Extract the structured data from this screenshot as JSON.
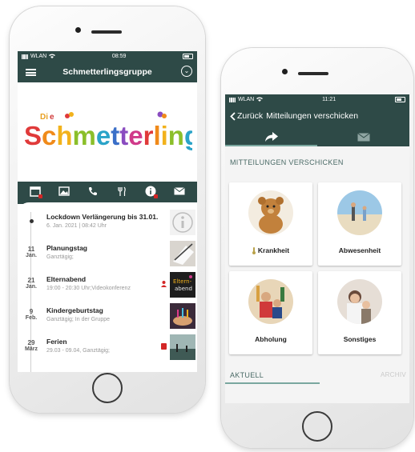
{
  "phone1": {
    "status": {
      "carrier": "WLAN",
      "time": "08:59"
    },
    "header": {
      "title": "Schmetterlingsgruppe",
      "menu_icon": "hamburger-icon",
      "toggle_icon": "chevron-down-icon"
    },
    "logo": {
      "prefix": "Die",
      "text": "Schmetterlinge"
    },
    "toolbar_icons": [
      "calendar-icon",
      "image-icon",
      "phone-icon",
      "cutlery-icon",
      "info-icon",
      "mail-icon"
    ],
    "feed": [
      {
        "day": "",
        "month": "",
        "title": "Lockdown Verlängerung bis 31.01.",
        "subtitle": "6. Jan. 2021 | 08:42 Uhr",
        "thumb": "info"
      },
      {
        "day": "11",
        "month": "Jan.",
        "title": "Planungstag",
        "subtitle": "Ganztägig;",
        "thumb": "paper"
      },
      {
        "day": "21",
        "month": "Jan.",
        "title": "Elternabend",
        "subtitle": "19:00 - 20:30 Uhr;Videokonferenz",
        "thumb": "chalk",
        "thumb_text": "Eltern-\nabend"
      },
      {
        "day": "9",
        "month": "Feb.",
        "title": "Kindergeburtstag",
        "subtitle": "Ganztägig; In der Gruppe",
        "thumb": "party"
      },
      {
        "day": "29",
        "month": "März",
        "title": "Ferien",
        "subtitle": "29.03 - 09.04, Ganztägig;",
        "thumb": "sea"
      }
    ],
    "colors": {
      "bar": "#2e4a47",
      "accent_red": "#d32626"
    }
  },
  "phone2": {
    "status": {
      "carrier": "WLAN",
      "time": "11:21"
    },
    "nav": {
      "back_label": "Zurück",
      "title": "Mitteilungen verschicken"
    },
    "tabs": [
      "share-icon",
      "mail-icon"
    ],
    "section_title": "MITTEILUNGEN VERSCHICKEN",
    "tiles": [
      {
        "label": "Krankheit",
        "image": "teddy-bear"
      },
      {
        "label": "Abwesenheit",
        "image": "beach-family"
      },
      {
        "label": "Abholung",
        "image": "parent-child"
      },
      {
        "label": "Sonstiges",
        "image": "mother-child"
      }
    ],
    "bottom_tabs": {
      "current": "AKTUELL",
      "archive": "ARCHIV"
    }
  }
}
